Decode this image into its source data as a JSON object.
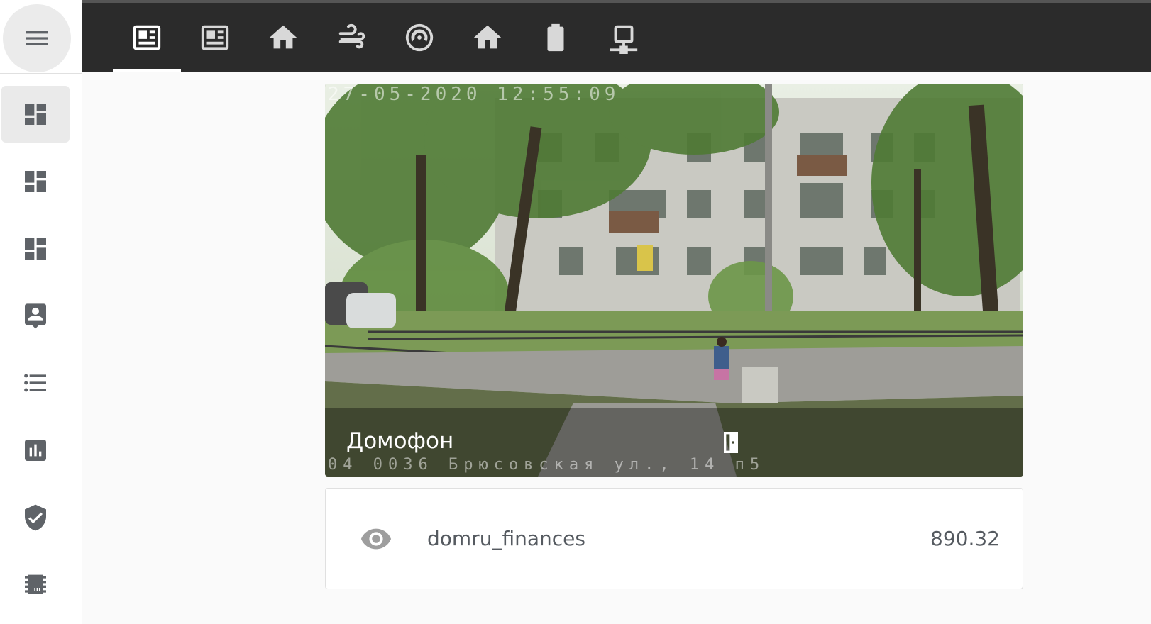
{
  "sidebar": {
    "menu_icon": "hamburger-menu-icon",
    "items": [
      {
        "name": "sidebar-item-overview",
        "icon": "dashboard-icon",
        "active": true
      },
      {
        "name": "sidebar-item-dashboard-2",
        "icon": "dashboard-icon",
        "active": false
      },
      {
        "name": "sidebar-item-dashboard-3",
        "icon": "dashboard-icon",
        "active": false
      },
      {
        "name": "sidebar-item-person",
        "icon": "account-box-icon",
        "active": false
      },
      {
        "name": "sidebar-item-list",
        "icon": "format-list-icon",
        "active": false
      },
      {
        "name": "sidebar-item-history",
        "icon": "chart-box-icon",
        "active": false
      },
      {
        "name": "sidebar-item-security",
        "icon": "shield-check-icon",
        "active": false
      },
      {
        "name": "sidebar-item-hardware",
        "icon": "chip-icon",
        "active": false
      }
    ]
  },
  "tabs": [
    {
      "name": "tab-overview",
      "icon": "newspaper-icon",
      "active": true
    },
    {
      "name": "tab-overview-2",
      "icon": "newspaper-icon",
      "active": false
    },
    {
      "name": "tab-home",
      "icon": "home-icon",
      "active": false
    },
    {
      "name": "tab-weather",
      "icon": "wind-icon",
      "active": false
    },
    {
      "name": "tab-vacuum",
      "icon": "robot-vacuum-icon",
      "active": false
    },
    {
      "name": "tab-home-2",
      "icon": "home-icon",
      "active": false
    },
    {
      "name": "tab-battery",
      "icon": "battery-icon",
      "active": false
    },
    {
      "name": "tab-network",
      "icon": "network-icon",
      "active": false
    }
  ],
  "camera": {
    "title": "Домофон",
    "timestamp": "27-05-2020 12:55:09",
    "overlay_text": "04 0036 Брюсовская ул., 14 п5",
    "action_icon": "door-icon"
  },
  "entity": {
    "icon": "eye-icon",
    "name": "domru_finances",
    "value": "890.32"
  },
  "colors": {
    "topbar": "#2b2b2b",
    "sidebar_icon": "#5f6368",
    "active_tab": "#ffffff",
    "background": "#fafafa"
  }
}
